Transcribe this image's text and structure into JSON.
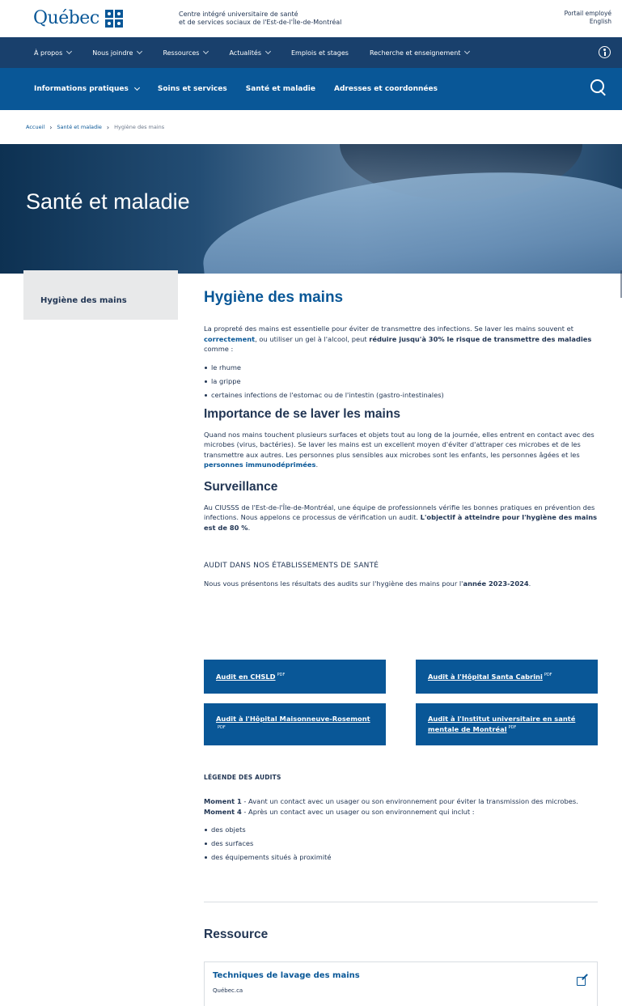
{
  "header": {
    "logo_word": "Québec",
    "org_line1": "Centre intégré universitaire de santé",
    "org_line2": "et de services sociaux de l'Est-de-l'Île-de-Montréal",
    "util_links": [
      "Portail employé",
      "English"
    ]
  },
  "nav_primary": [
    "À propos",
    "Nous joindre",
    "Ressources",
    "Actualités",
    "Emplois et stages",
    "Recherche et enseignement"
  ],
  "nav_secondary": [
    "Informations pratiques",
    "Soins et services",
    "Santé et maladie",
    "Adresses et coordonnées"
  ],
  "breadcrumb": {
    "items": [
      "Accueil",
      "Santé et maladie",
      "Hygiène des mains"
    ],
    "sep": "›"
  },
  "hero": {
    "title": "Santé et maladie"
  },
  "sidebar": {
    "item": "Hygiène des mains"
  },
  "main": {
    "title": "Hygiène des mains",
    "lead": {
      "t1": "La propreté des mains est essentielle pour éviter de transmettre des infections. Se laver les mains souvent et ",
      "link": "correctement",
      "t2": ", ou utiliser un gel à l'alcool, peut ",
      "bold": "réduire jusqu'à 30% le risque de transmettre des maladies",
      "t3": " comme :"
    },
    "list1": [
      "le rhume",
      "la grippe",
      "certaines infections de l'estomac ou de l'intestin (gastro-intestinales)"
    ],
    "h_importance": "Importance de se laver les mains",
    "importance": {
      "t1": "Quand nos mains touchent plusieurs surfaces et objets tout au long de la journée, elles entrent en contact avec des microbes (virus, bactéries). Se laver les mains est un excellent moyen d'éviter d'attraper ces microbes et de les transmettre aux autres. Les personnes plus sensibles aux microbes sont les enfants, les personnes âgées et les ",
      "link": "personnes immunodéprimées",
      "t2": "."
    },
    "h_surveillance": "Surveillance",
    "surveillance": {
      "t1": "Au CIUSSS de l'Est-de-l'Île-de-Montréal, une équipe de professionnels vérifie les bonnes pratiques en prévention des infections. Nous appelons ce processus de vérification un audit. ",
      "bold": "L'objectif à atteindre pour l'hygiène des mains est de 80 %",
      "t2": "."
    },
    "audit_heading": "AUDIT DANS NOS ÉTABLISSEMENTS DE SANTÉ",
    "audit_intro": {
      "t1": "Nous vous présentons les résultats des audits sur l'hygiène des mains pour l'",
      "bold": "année 2023-2024",
      "t2": "."
    }
  },
  "audit_cards": [
    {
      "label": "Audit en CHSLD",
      "tag": "PDF"
    },
    {
      "label": "Audit à l'Hôpital Santa Cabrini",
      "tag": "PDF"
    },
    {
      "label": "Audit à l'Hôpital Maisonneuve-Rosemont",
      "tag": "PDF"
    },
    {
      "label": "Audit à l'Institut universitaire en santé mentale de Montréal",
      "tag": "PDF"
    }
  ],
  "legend": {
    "heading": "LÉGENDE DES AUDITS",
    "m1_label": "Moment 1",
    "m1_text": " - Avant un contact avec un usager ou son environnement pour éviter la transmission des microbes.",
    "m4_label": "Moment 4",
    "m4_text": " - Après un contact avec un usager ou son environnement qui inclut :",
    "list": [
      "des objets",
      "des surfaces",
      "des équipements situés à proximité"
    ]
  },
  "resource": {
    "heading": "Ressource",
    "title": "Techniques de lavage des mains",
    "source": "Québec.ca"
  },
  "colors": {
    "brand": "#095797",
    "nav_dark": "#19406c",
    "text": "#223654"
  }
}
